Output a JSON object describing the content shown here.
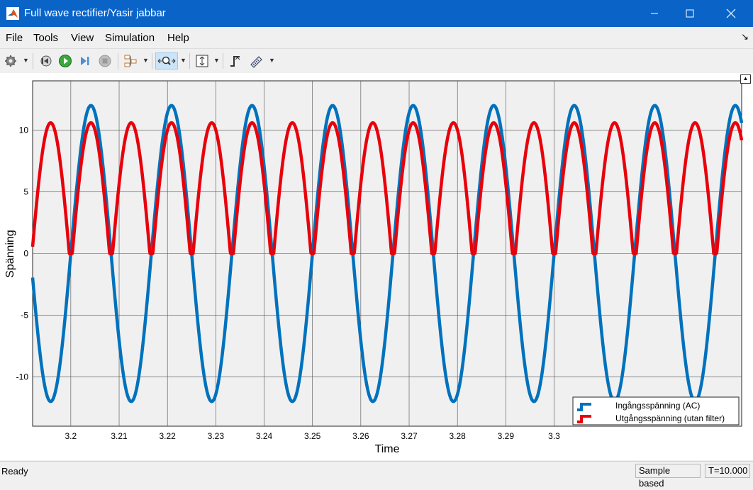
{
  "window": {
    "title": "Full wave rectifier/Yasir jabbar"
  },
  "menu": [
    "File",
    "Tools",
    "View",
    "Simulation",
    "Help"
  ],
  "toolbar": {
    "items": [
      "gear-icon",
      "step-back-icon",
      "run-icon",
      "step-forward-icon",
      "stop-icon",
      "highlight-block-icon",
      "zoom-icon",
      "autoscale-icon",
      "triggers-icon",
      "measurements-icon"
    ]
  },
  "chart_data": {
    "type": "line",
    "xlabel": "Time",
    "ylabel": "Spänning",
    "xlim": [
      3.1921,
      3.3388
    ],
    "ylim": [
      -14,
      14
    ],
    "xticks": [
      3.2,
      3.21,
      3.22,
      3.23,
      3.24,
      3.25,
      3.26,
      3.27,
      3.28,
      3.29,
      3.3
    ],
    "xtick_labels": [
      "3.2",
      "3.21",
      "3.22",
      "3.23",
      "3.24",
      "3.25",
      "3.26",
      "3.27",
      "3.28",
      "3.29",
      "3.3"
    ],
    "yticks": [
      -10,
      -5,
      0,
      5,
      10
    ],
    "ytick_labels": [
      "-10",
      "-5",
      "0",
      "5",
      "10"
    ],
    "grid": true,
    "legend_position": "bottom-right",
    "series": [
      {
        "name": "Ingångsspänning (AC)",
        "color": "#0072bd",
        "function": "sine",
        "amplitude": 12,
        "frequency_hz": 60,
        "zero_crossing_rising_at": 3.2
      },
      {
        "name": "Utgångsspänning (utan filter)",
        "color": "#e8000b",
        "function": "rectified_sine",
        "amplitude": 10.6,
        "offset": 1.4,
        "clip_min": 0,
        "frequency_hz": 60,
        "zero_crossing_rising_at": 3.2
      }
    ]
  },
  "status": {
    "left": "Ready",
    "mode": "Sample based",
    "time": "T=10.000"
  }
}
